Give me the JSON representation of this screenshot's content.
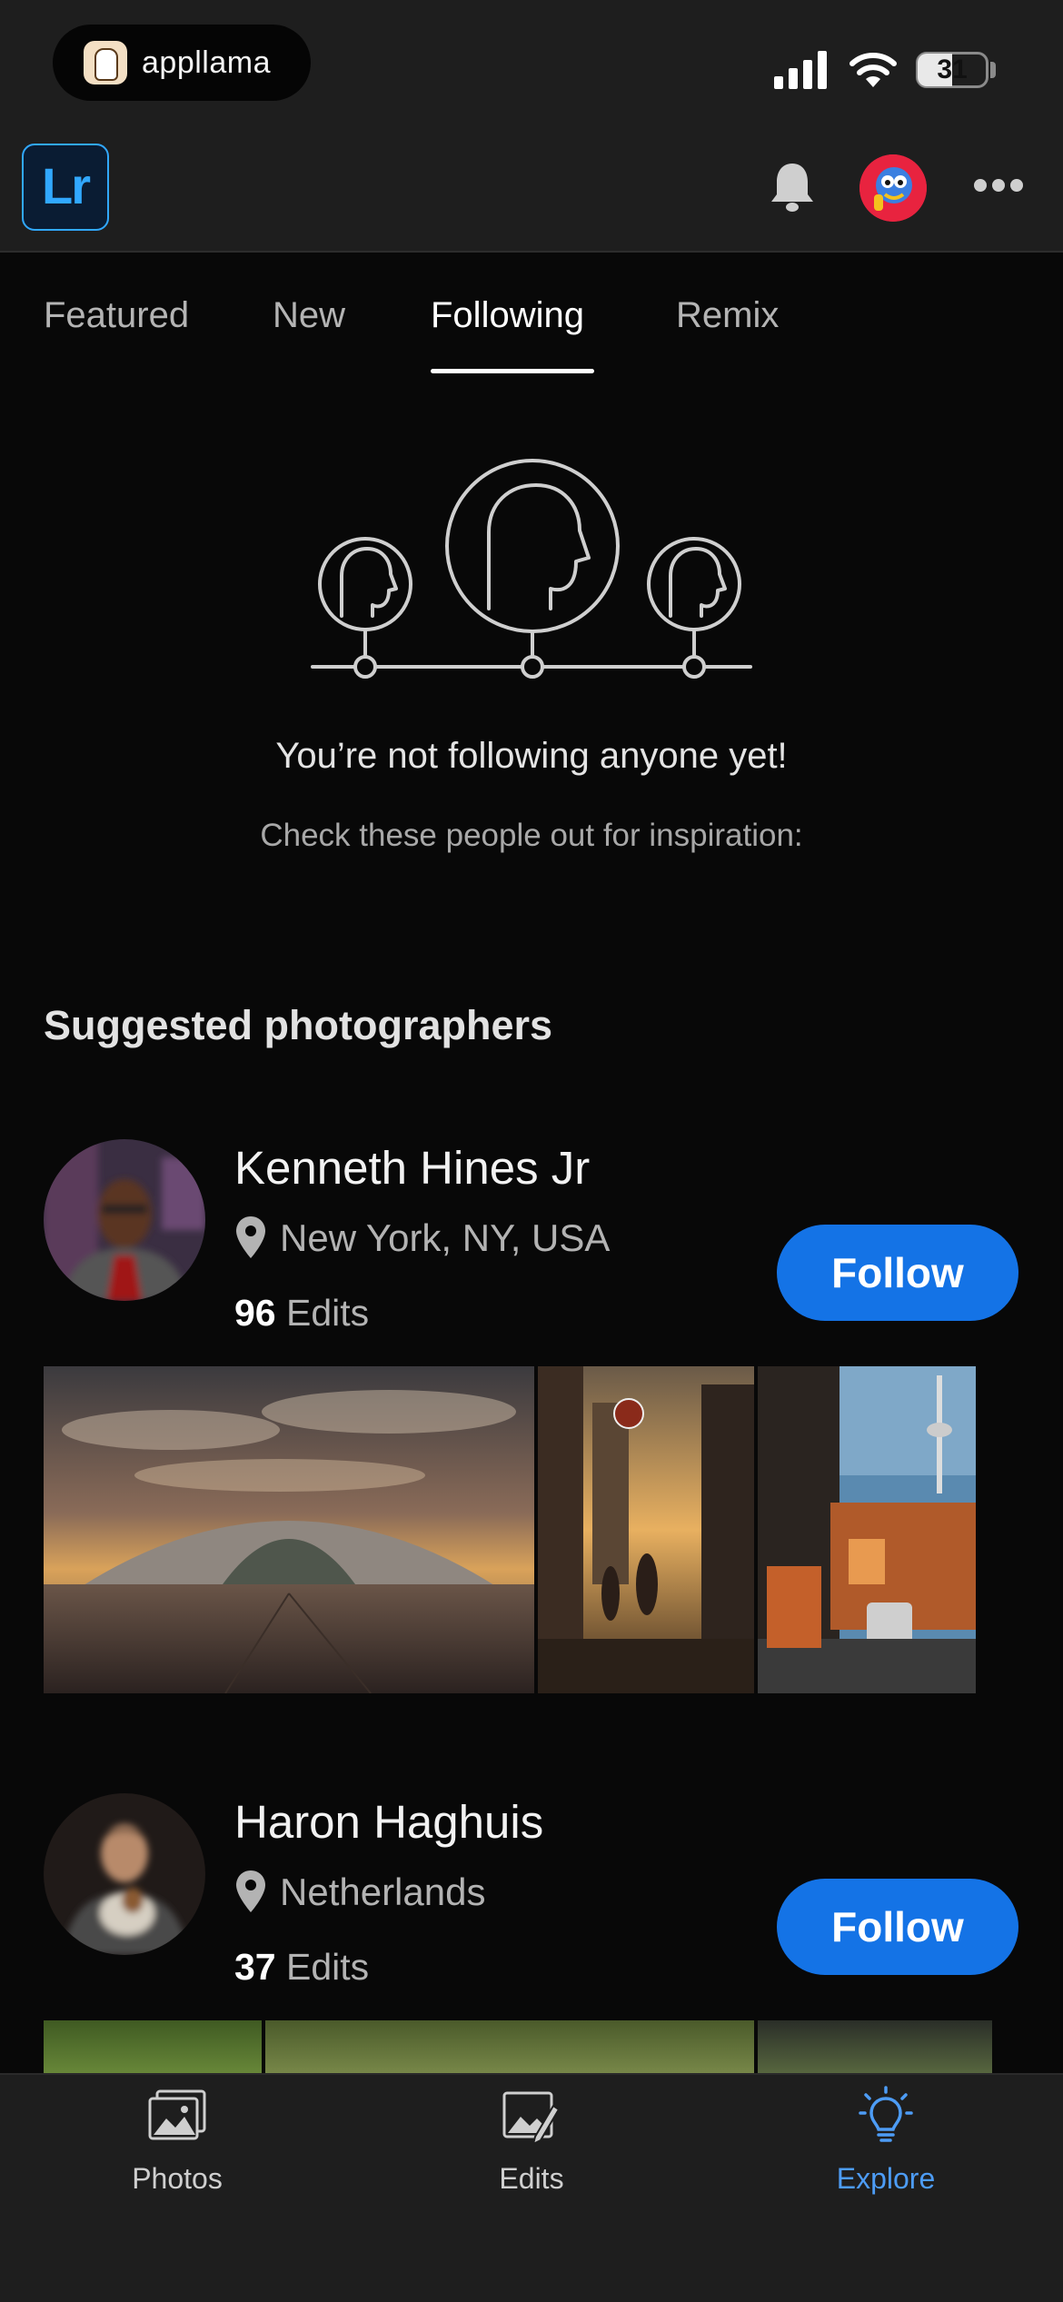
{
  "status_bar": {
    "app_pill_label": "appllama",
    "battery": "31",
    "signal_icon": "cellular-signal-icon",
    "wifi_icon": "wifi-icon"
  },
  "header": {
    "logo_text": "Lr",
    "icons": [
      "bell-icon",
      "profile-avatar",
      "more-icon"
    ]
  },
  "tabs": [
    {
      "label": "Featured"
    },
    {
      "label": "New"
    },
    {
      "label": "Following",
      "active": true
    },
    {
      "label": "Remix"
    }
  ],
  "empty_state": {
    "title": "You’re not following anyone yet!",
    "subtitle": "Check these people out for inspiration:"
  },
  "section_title": "Suggested photographers",
  "photographers": [
    {
      "name": "Kenneth Hines Jr",
      "location": "New York, NY, USA",
      "edits_count": "96",
      "edits_label": "Edits",
      "follow_label": "Follow"
    },
    {
      "name": "Haron Haghuis",
      "location": "Netherlands",
      "edits_count": "37",
      "edits_label": "Edits",
      "follow_label": "Follow"
    }
  ],
  "bottom_nav": [
    {
      "label": "Photos",
      "icon": "photos-icon"
    },
    {
      "label": "Edits",
      "icon": "edits-icon"
    },
    {
      "label": "Explore",
      "icon": "lightbulb-icon",
      "active": true
    }
  ],
  "colors": {
    "accent": "#1473e6",
    "lr_blue": "#31a8ff",
    "active_nav": "#4d9cf5",
    "background": "#080808",
    "bar_background": "#1e1e1e"
  }
}
